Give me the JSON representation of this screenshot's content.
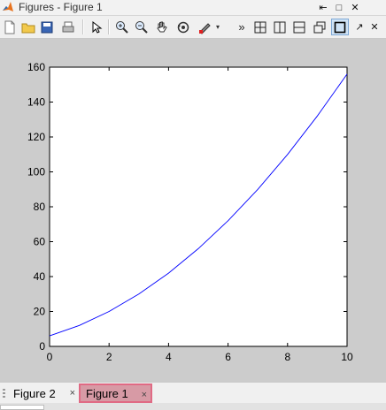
{
  "window": {
    "title": "Figures - Figure 1",
    "controls": [
      "dock-arrow-icon",
      "maximize-icon",
      "close-icon"
    ]
  },
  "toolbar": {
    "tools": [
      {
        "name": "new-figure-icon",
        "glyph": "🗋"
      },
      {
        "name": "open-file-icon",
        "glyph": "📂"
      },
      {
        "name": "save-icon",
        "glyph": "💾"
      },
      {
        "name": "print-icon",
        "glyph": "🖨"
      },
      {
        "name": "edit-plot-arrow-icon",
        "glyph": "➚"
      },
      {
        "name": "zoom-in-icon",
        "glyph": "🔍"
      },
      {
        "name": "zoom-out-icon",
        "glyph": "🔍"
      },
      {
        "name": "pan-hand-icon",
        "glyph": "✋"
      },
      {
        "name": "rotate-3d-icon",
        "glyph": "⟲"
      },
      {
        "name": "data-cursor-icon",
        "glyph": "✎"
      },
      {
        "name": "more-tools-icon",
        "glyph": "»"
      },
      {
        "name": "tile-layout-icon",
        "glyph": "⊞"
      },
      {
        "name": "left-right-layout-icon",
        "glyph": "◫"
      },
      {
        "name": "top-bottom-layout-icon",
        "glyph": "⊟"
      },
      {
        "name": "float-windows-icon",
        "glyph": "❐"
      },
      {
        "name": "maximize-figure-icon",
        "glyph": "□"
      },
      {
        "name": "dock-arrow-icon",
        "glyph": "↗"
      },
      {
        "name": "close-icon",
        "glyph": "✕"
      }
    ]
  },
  "tabs": [
    {
      "label": "Figure 2",
      "close": "×",
      "selected": false
    },
    {
      "label": "Figure 1",
      "close": "×",
      "selected": true
    }
  ],
  "chart_data": {
    "type": "line",
    "title": "",
    "xlabel": "",
    "ylabel": "",
    "xlim": [
      0,
      10
    ],
    "ylim": [
      0,
      160
    ],
    "xticks": [
      0,
      2,
      4,
      6,
      8,
      10
    ],
    "yticks": [
      0,
      20,
      40,
      60,
      80,
      100,
      120,
      140,
      160
    ],
    "grid": false,
    "series": [
      {
        "color": "#0000ff",
        "x": [
          0,
          1,
          2,
          3,
          4,
          5,
          6,
          7,
          8,
          9,
          10
        ],
        "y": [
          6,
          12,
          20,
          30,
          42,
          56,
          72,
          90,
          110,
          132,
          156
        ]
      }
    ]
  }
}
